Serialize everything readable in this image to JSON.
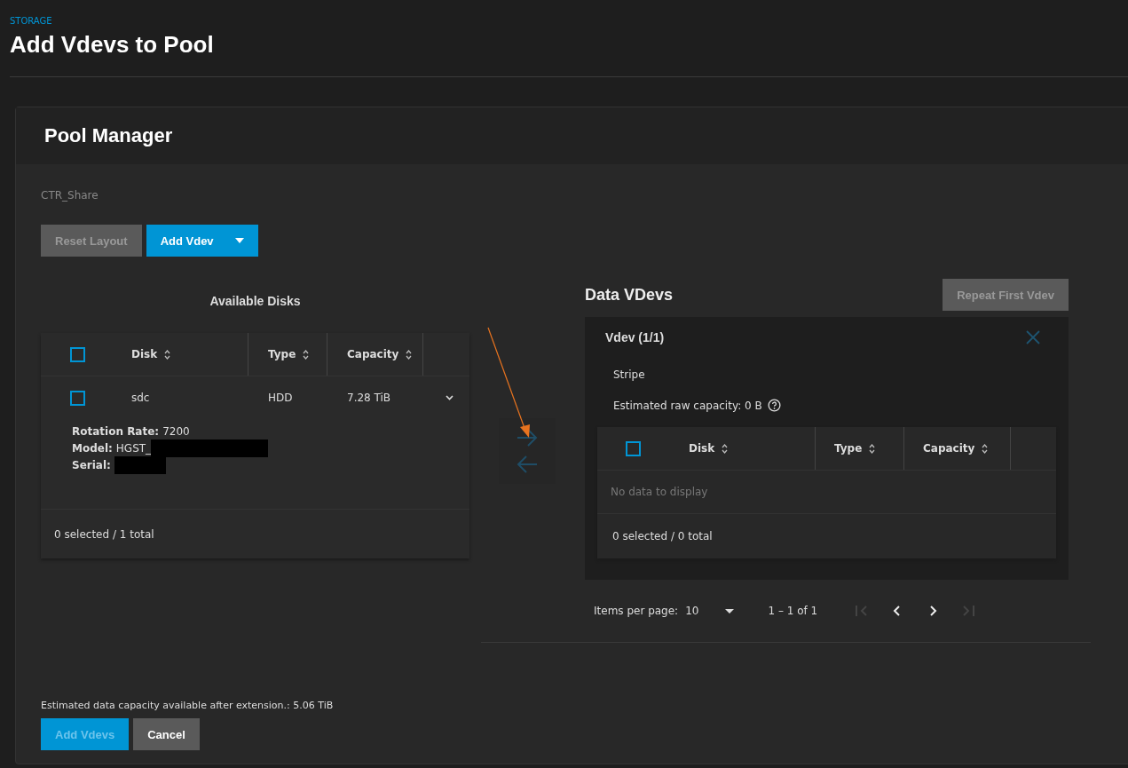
{
  "breadcrumb": "STORAGE",
  "page_title": "Add Vdevs to Pool",
  "card": {
    "title": "Pool Manager",
    "pool_name": "CTR_Share",
    "toolbar": [
      {
        "label": "Reset Layout",
        "disabled": true,
        "kind": "plain"
      },
      {
        "label": "Add Vdev",
        "kind": "split"
      }
    ],
    "available_disks": {
      "title": "Available Disks",
      "header_checked": false,
      "columns": [
        "Disk",
        "Type",
        "Capacity"
      ],
      "rows": [
        {
          "checked": false,
          "expanded": true,
          "disk": "sdc",
          "type": "HDD",
          "capacity": "7.28 TiB",
          "details": [
            {
              "label": "Rotation Rate:",
              "value": "7200",
              "redacted": false
            },
            {
              "label": "Model:",
              "value": "HGST_",
              "redacted": true
            },
            {
              "label": "Serial:",
              "redacted": true
            }
          ]
        }
      ],
      "footer": "0 selected / 1 total"
    },
    "move_buttons": [
      {
        "kind": "right",
        "disabled": true
      },
      {
        "kind": "left",
        "disabled": true
      }
    ],
    "data_vdevs": {
      "title": "Data VDevs",
      "repeat_button": {
        "label": "Repeat First Vdev",
        "disabled": true
      },
      "vdevs": [
        {
          "title": "Vdev (1/1)",
          "layout": "Stripe",
          "capacity": "Estimated raw capacity: 0 B",
          "header_checked": false,
          "columns": [
            "Disk",
            "Type",
            "Capacity"
          ],
          "empty": "No data to display",
          "footer": "0 selected / 0 total"
        }
      ]
    },
    "paginator": {
      "label": "Items per page:",
      "page_size": "10",
      "range": "1 – 1 of 1",
      "nav": [
        {
          "kind": "first",
          "disabled": true
        },
        {
          "kind": "prev",
          "disabled": false
        },
        {
          "kind": "next",
          "disabled": false
        },
        {
          "kind": "last",
          "disabled": true
        }
      ]
    },
    "estimate": "Estimated data capacity available after extension.: 5.06 TiB",
    "actions": [
      {
        "label": "Add Vdevs",
        "kind": "primary",
        "disabled": true
      },
      {
        "label": "Cancel",
        "kind": "secondary",
        "disabled": false
      }
    ]
  }
}
